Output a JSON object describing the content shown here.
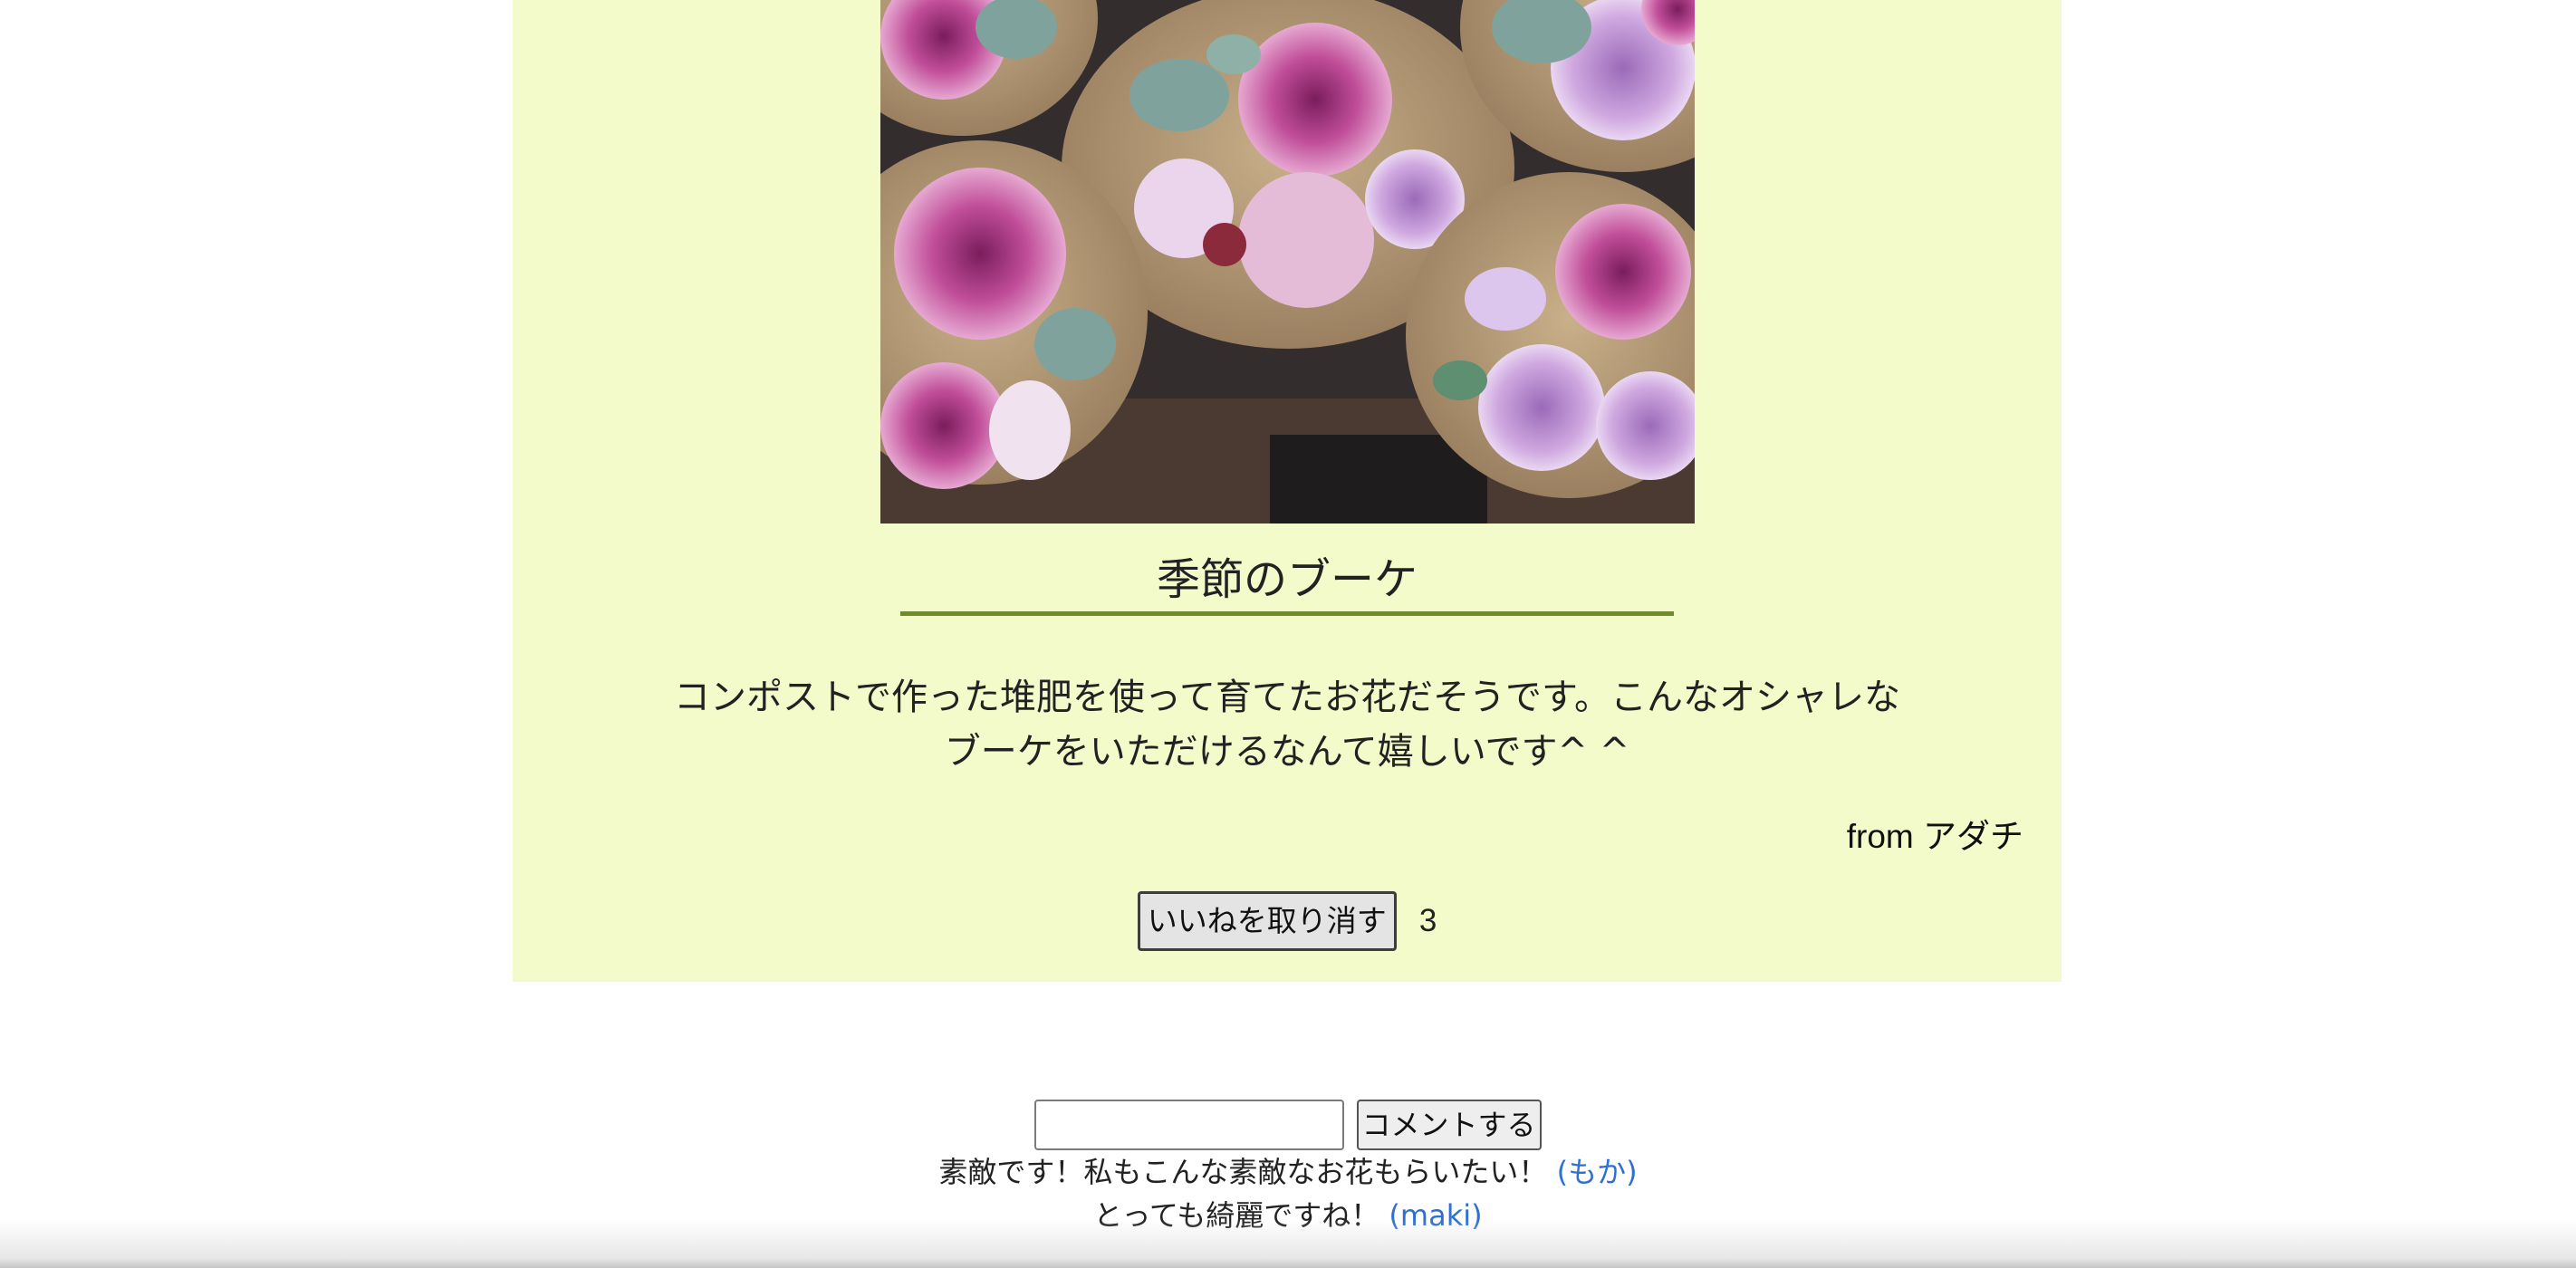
{
  "post": {
    "title": "季節のブーケ",
    "body_line1": "コンポストで作った堆肥を使って育てたお花だそうです。こんなオシャレな",
    "body_line2": "ブーケをいただけるなんて嬉しいです^ ^",
    "author": "from アダチ",
    "image": "flower-bouquets-photo",
    "like_button_label": "いいねを取り消す",
    "like_count": "3"
  },
  "comment_form": {
    "input_value": "",
    "submit_label": "コメントする"
  },
  "comments": [
    {
      "text": "素敵です！私もこんな素敵なお花もらいたい！",
      "user": "(もか)"
    },
    {
      "text": "とっても綺麗ですね！",
      "user": "(maki)"
    }
  ],
  "colors": {
    "card_background": "#f4fbcb",
    "title_underline": "#6f8c26",
    "link": "#2f6fd0"
  }
}
